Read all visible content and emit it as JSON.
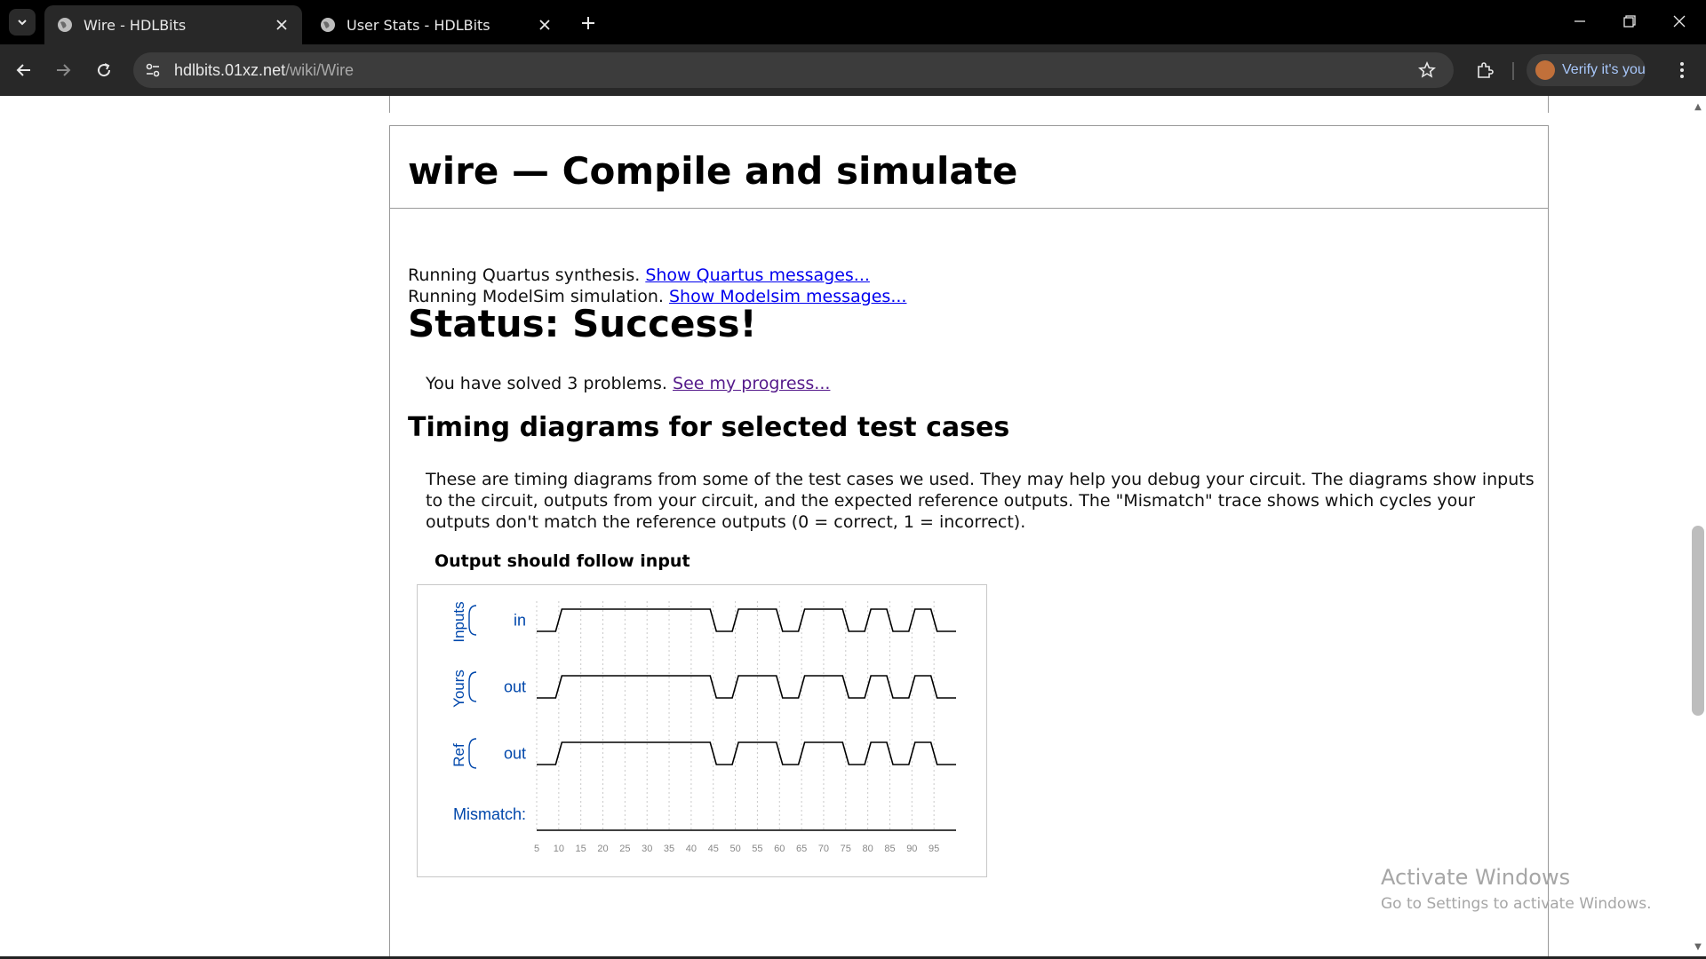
{
  "browser": {
    "tabs": [
      {
        "title": "Wire - HDLBits",
        "active": true
      },
      {
        "title": "User Stats - HDLBits",
        "active": false
      }
    ],
    "url_host": "hdlbits.01xz.net",
    "url_path": "/wiki/Wire",
    "profile_label": "Verify it's you",
    "icons": [
      "tab-search-icon",
      "globe-icon",
      "close-icon",
      "plus-icon",
      "minimize-icon",
      "restore-icon",
      "back-icon",
      "forward-icon",
      "reload-icon",
      "site-info-icon",
      "star-icon",
      "extensions-icon",
      "kebab-menu-icon"
    ]
  },
  "page": {
    "heading": "wire — Compile and simulate",
    "quartus_text": "Running Quartus synthesis.",
    "quartus_link": "Show Quartus messages...",
    "modelsim_text": "Running ModelSim simulation.",
    "modelsim_link": "Show Modelsim messages...",
    "status": "Status: Success!",
    "solved_text": "You have solved 3 problems.",
    "progress_link": "See my progress...",
    "timing_heading": "Timing diagrams for selected test cases",
    "timing_text": "These are timing diagrams from some of the test cases we used. They may help you debug your circuit. The diagrams show inputs to the circuit, outputs from your circuit, and the expected reference outputs. The \"Mismatch\" trace shows which cycles your outputs don't match the reference outputs (0 = correct, 1 = incorrect).",
    "diagram_title": "Output should follow input"
  },
  "timing_diagram": {
    "groups": [
      "Inputs",
      "Yours",
      "Ref"
    ],
    "signal_names": [
      "in",
      "out",
      "out"
    ],
    "mismatch_label": "Mismatch:",
    "time_ticks": [
      5,
      10,
      15,
      20,
      25,
      30,
      35,
      40,
      45,
      50,
      55,
      60,
      65,
      70,
      75,
      80,
      85,
      90,
      95
    ],
    "high_intervals": [
      [
        10,
        45
      ],
      [
        50,
        60
      ],
      [
        65,
        75
      ],
      [
        80,
        85
      ],
      [
        90,
        95
      ]
    ],
    "time_range": [
      5,
      100
    ],
    "label_color": "#0047ab",
    "wave_color": "#000000"
  },
  "watermark": {
    "title": "Activate Windows",
    "subtitle": "Go to Settings to activate Windows."
  }
}
